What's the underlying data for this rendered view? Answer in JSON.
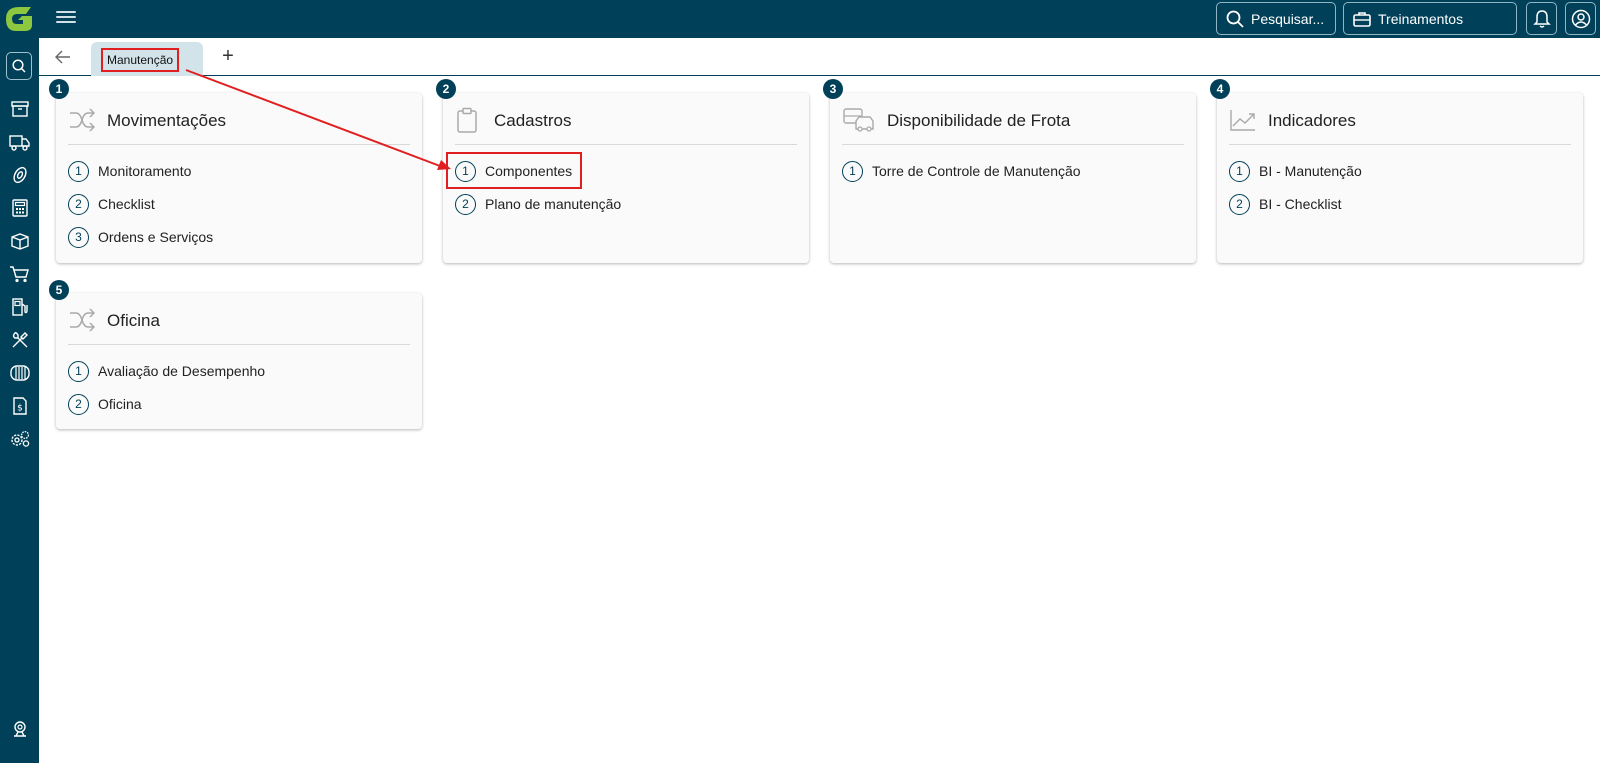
{
  "topbar": {
    "search_label": "Pesquisar...",
    "training_label": "Treinamentos",
    "icons": [
      "app-logo",
      "menu-icon",
      "search-icon",
      "briefcase-icon",
      "bell-icon",
      "user-circle-icon"
    ]
  },
  "sidebar": {
    "icons": [
      "search-icon",
      "archive-icon",
      "truck-icon",
      "tire-icon",
      "calculator-icon",
      "box-icon",
      "cart-icon",
      "fuel-icon",
      "tools-icon",
      "tread-icon",
      "invoice-icon",
      "settings-icon",
      "support-icon"
    ]
  },
  "tabs": {
    "active_label": "Manutenção",
    "add_label": "+"
  },
  "colors": {
    "brand": "#004058",
    "accent": "#8dc63f",
    "highlight": "#e02020",
    "tab_bg": "#d3e3ea"
  },
  "cards": [
    {
      "badge": "1",
      "title": "Movimentações",
      "icon": "shuffle-icon",
      "items": [
        {
          "num": "1",
          "label": "Monitoramento"
        },
        {
          "num": "2",
          "label": "Checklist"
        },
        {
          "num": "3",
          "label": "Ordens e Serviços"
        }
      ]
    },
    {
      "badge": "2",
      "title": "Cadastros",
      "icon": "clipboard-icon",
      "items": [
        {
          "num": "1",
          "label": "Componentes"
        },
        {
          "num": "2",
          "label": "Plano de manutenção"
        }
      ]
    },
    {
      "badge": "3",
      "title": "Disponibilidade de Frota",
      "icon": "fleet-icon",
      "items": [
        {
          "num": "1",
          "label": "Torre de Controle de Manutenção"
        }
      ]
    },
    {
      "badge": "4",
      "title": "Indicadores",
      "icon": "chart-trend-icon",
      "items": [
        {
          "num": "1",
          "label": "BI - Manutenção"
        },
        {
          "num": "2",
          "label": "BI - Checklist"
        }
      ]
    },
    {
      "badge": "5",
      "title": "Oficina",
      "icon": "shuffle-icon",
      "items": [
        {
          "num": "1",
          "label": "Avaliação de Desempenho"
        },
        {
          "num": "2",
          "label": "Oficina"
        }
      ]
    }
  ]
}
